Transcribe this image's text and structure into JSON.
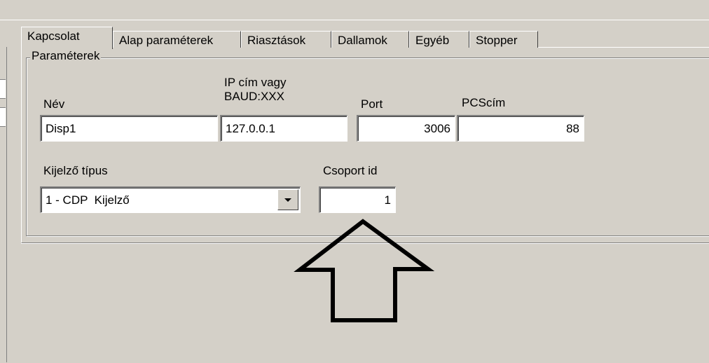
{
  "tabs": [
    {
      "label": "Kapcsolat",
      "active": true
    },
    {
      "label": "Alap paraméterek",
      "active": false
    },
    {
      "label": "Riasztások",
      "active": false
    },
    {
      "label": "Dallamok",
      "active": false
    },
    {
      "label": "Egyéb",
      "active": false
    },
    {
      "label": "Stopper",
      "active": false
    }
  ],
  "group": {
    "title": "Paraméterek",
    "fields": {
      "nev": {
        "label": "Név",
        "value": "Disp1"
      },
      "ip": {
        "label_line1": "IP cím vagy",
        "label_line2": "BAUD:XXX",
        "value": "127.0.0.1"
      },
      "port": {
        "label": "Port",
        "value": "3006"
      },
      "pcscim": {
        "label": "PCScím",
        "value": "88"
      },
      "kijelzo_tipus": {
        "label": "Kijelző típus",
        "value": "1 - CDP  Kijelző"
      },
      "csoport_id": {
        "label": "Csoport id",
        "value": "1"
      }
    }
  },
  "annotation": {
    "icon": "up-arrow-icon",
    "color": "#000000"
  },
  "colors": {
    "face": "#d4d0c8",
    "highlight": "#ffffff",
    "shadow": "#808080"
  }
}
